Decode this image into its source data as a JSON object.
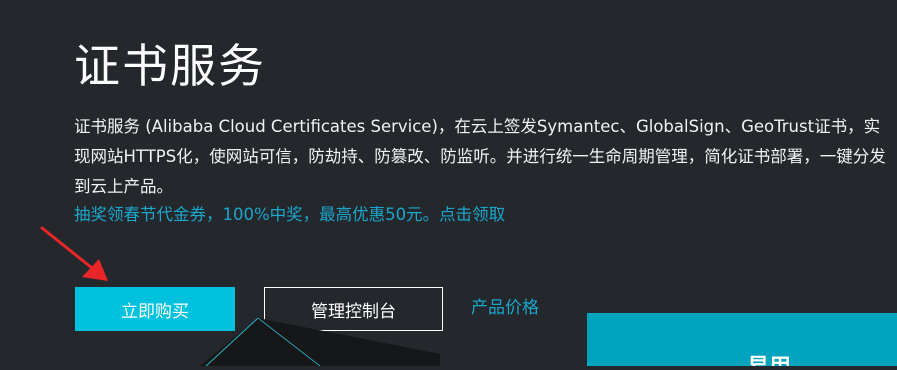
{
  "page": {
    "title": "证书服务",
    "description": "证书服务 (Alibaba Cloud Certificates Service)，在云上签发Symantec、GlobalSign、GeoTrust证书，实现网站HTTPS化，使网站可信，防劫持、防篡改、防监听。并进行统一生命周期管理，简化证书部署，一键分发到云上产品。",
    "promo_link": "抽奖领春节代金券，100%中奖，最高优惠50元。点击领取"
  },
  "actions": {
    "buy_label": "立即购买",
    "console_label": "管理控制台",
    "price_label": "产品价格"
  },
  "side_panel": {
    "partial_text": "易用"
  },
  "colors": {
    "background": "#24272b",
    "accent": "#00c1de",
    "link": "#1aa7cc",
    "annotation_arrow": "#e8262a"
  },
  "icons": {
    "annotation": "red-arrow-icon"
  }
}
